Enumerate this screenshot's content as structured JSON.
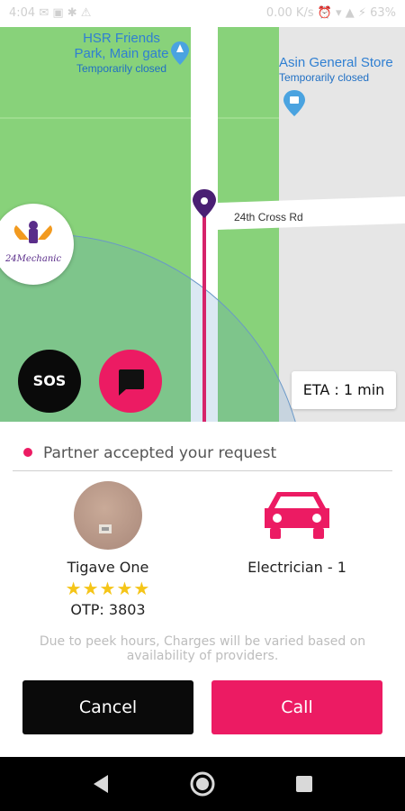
{
  "status_bar": {
    "left": "4:04  ✉  ▣  ✱  ⚠",
    "right": "0.00 K/s  ⏰  ▾  ▲  ⚡ 63%"
  },
  "map": {
    "poi_1": {
      "name_line1": "HSR Friends",
      "name_line2": "Park, Main gate",
      "status": "Temporarily closed"
    },
    "poi_2": {
      "name": "Asin General Store",
      "status": "Temporarily closed"
    },
    "road_label": "24th Cross Rd",
    "logo_text": "24Mechanic",
    "sos_label": "SOS",
    "eta": "ETA : 1 min"
  },
  "panel": {
    "status_text": "Partner accepted your request",
    "partner_name": "Tigave One",
    "rating_stars": "★★★★★",
    "rating": 5,
    "otp": "OTP: 3803",
    "service": "Electrician - 1",
    "note_line1": "Due to peek hours, Charges will be varied based on",
    "note_line2": "availability of providers.",
    "cancel_label": "Cancel",
    "call_label": "Call"
  },
  "colors": {
    "accent": "#ec1b63",
    "dark": "#0a0a0a",
    "map_green": "#88d27a"
  },
  "icons": [
    "location-pin-icon",
    "chat-icon",
    "car-icon",
    "back-icon",
    "home-icon",
    "recents-icon"
  ]
}
